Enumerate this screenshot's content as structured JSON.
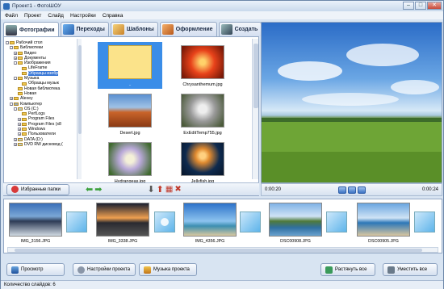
{
  "window": {
    "title": "Проект1 - ФотоШОУ"
  },
  "menu": [
    "Файл",
    "Проект",
    "Слайд",
    "Настройки",
    "Справка"
  ],
  "tabs": [
    {
      "label": "Фотографии",
      "active": true,
      "icon": "camera-icon"
    },
    {
      "label": "Переходы",
      "active": false,
      "icon": "transitions-icon"
    },
    {
      "label": "Шаблоны",
      "active": false,
      "icon": "templates-icon"
    },
    {
      "label": "Оформление",
      "active": false,
      "icon": "design-icon"
    },
    {
      "label": "Создать",
      "active": false,
      "icon": "create-icon"
    }
  ],
  "tree": [
    {
      "label": "Рабочий стол",
      "level": 0
    },
    {
      "label": "Библиотеки",
      "level": 1
    },
    {
      "label": "Видео",
      "level": 2
    },
    {
      "label": "Документы",
      "level": 2
    },
    {
      "label": "Изображения",
      "level": 2
    },
    {
      "label": "LifeFrame",
      "level": 3
    },
    {
      "label": "Образцы изобр",
      "level": 3,
      "selected": true
    },
    {
      "label": "Музыка",
      "level": 2
    },
    {
      "label": "Образцы музык",
      "level": 3
    },
    {
      "label": "Новая библиотека",
      "level": 2
    },
    {
      "label": "Новая",
      "level": 2
    },
    {
      "label": "Alexey",
      "level": 1
    },
    {
      "label": "Компьютер",
      "level": 1
    },
    {
      "label": "OS (C:)",
      "level": 2
    },
    {
      "label": "PerfLogs",
      "level": 3
    },
    {
      "label": "Program Files",
      "level": 3
    },
    {
      "label": "Program Files (x8",
      "level": 3
    },
    {
      "label": "Windows",
      "level": 3
    },
    {
      "label": "Пользователи",
      "level": 3
    },
    {
      "label": "DATA (D:)",
      "level": 2
    },
    {
      "label": "DVD RW дисковод (",
      "level": 2
    }
  ],
  "thumbnails": [
    {
      "label": "..",
      "selected": true
    },
    {
      "label": "Chrysanthemum.jpg"
    },
    {
      "label": "Desert.jpg"
    },
    {
      "label": "ExEditTemp755.jpg"
    },
    {
      "label": "Hydrangeas.jpg"
    },
    {
      "label": "Jellyfish.jpg"
    }
  ],
  "left_bottom": {
    "favorites_label": "Избранные папки"
  },
  "player": {
    "time_start": "0:00:20",
    "time_end": "0:00:24"
  },
  "slides": [
    {
      "label": "IMG_3156.JPG"
    },
    {
      "label": "IMG_3338.JPG"
    },
    {
      "label": "IMG_4356.JPG"
    },
    {
      "label": "DSC00908.JPG"
    },
    {
      "label": "DSC00905.JPG"
    }
  ],
  "footer": {
    "preview": "Просмотр",
    "project_settings": "Настройки проекта",
    "project_music": "Музыка проекта",
    "stretch_all": "Растянуть все",
    "shrink_all": "Уместить все"
  },
  "status": {
    "slides_count": "Количество слайдов: 6"
  },
  "colors": {
    "accent": "#3a8de8",
    "selection": "#3b78d6"
  }
}
